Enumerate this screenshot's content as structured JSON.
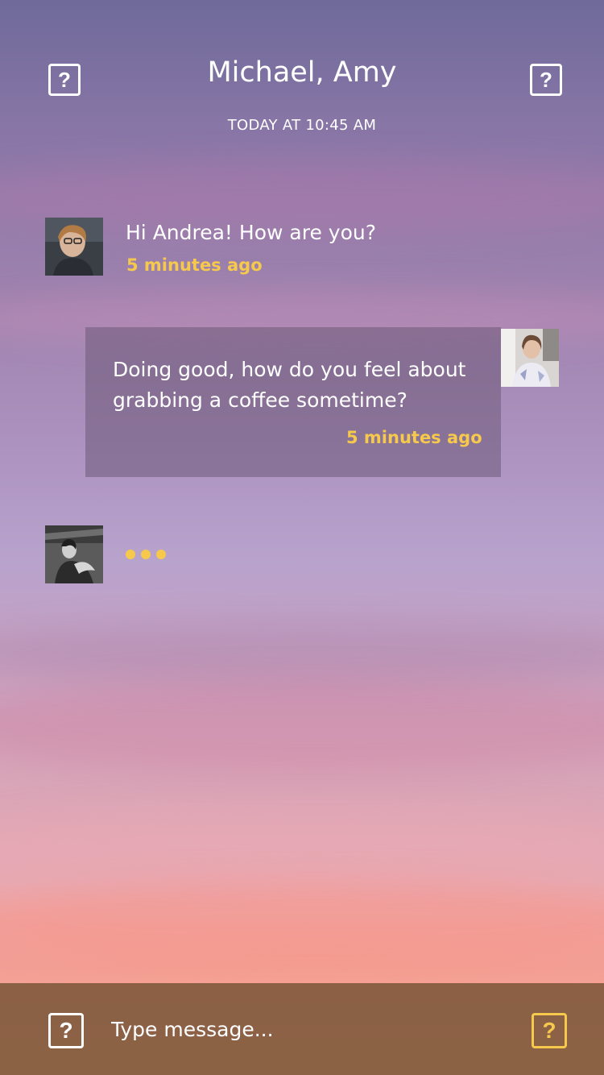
{
  "header": {
    "title": "Michael, Amy",
    "subtitle": "TODAY AT 10:45 AM",
    "left_icon": "help-icon",
    "right_icon": "help-icon",
    "icon_glyph": "?"
  },
  "messages": [
    {
      "sender": "Michael",
      "avatar": "avatar-michael",
      "text": "Hi Andrea! How are you?",
      "time": "5 minutes ago"
    },
    {
      "sender": "Andrea",
      "avatar": "avatar-andrea",
      "text": "Doing good, how do you feel about grabbing a coffee sometime?",
      "time": "5 minutes ago"
    },
    {
      "sender": "Amy",
      "avatar": "avatar-amy",
      "typing": true
    }
  ],
  "composer": {
    "placeholder": "Type message...",
    "left_icon": "help-icon",
    "right_icon": "help-icon",
    "icon_glyph": "?"
  },
  "colors": {
    "accent": "#f6c94d",
    "text": "#ffffff",
    "footer": "#785537"
  }
}
